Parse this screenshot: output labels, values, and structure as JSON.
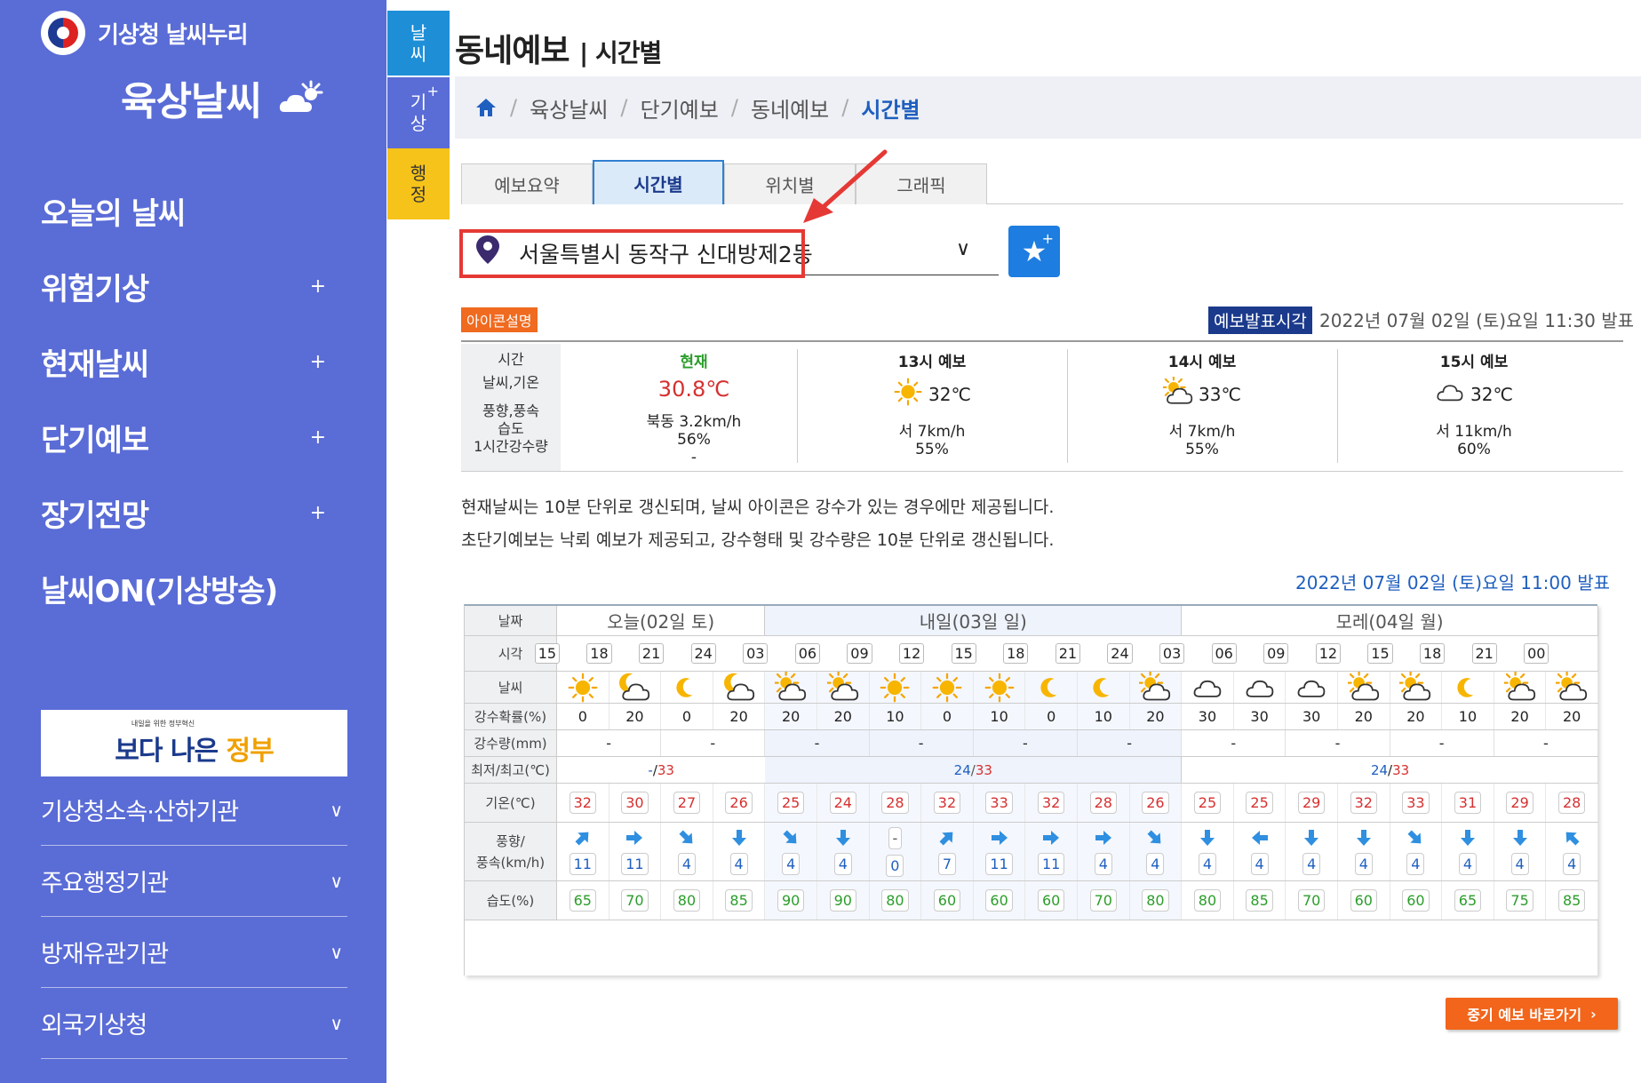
{
  "brand": {
    "name": "기상청 날씨누리"
  },
  "section_title": "육상날씨",
  "nav": [
    {
      "label": "오늘의 날씨",
      "plus": ""
    },
    {
      "label": "위험기상",
      "plus": "+"
    },
    {
      "label": "현재날씨",
      "plus": "+"
    },
    {
      "label": "단기예보",
      "plus": "+"
    },
    {
      "label": "장기전망",
      "plus": "+"
    },
    {
      "label": "날씨ON(기상방송)",
      "plus": ""
    }
  ],
  "banner": {
    "small": "내일을 위한 정부혁신",
    "big_a": "보다 나은",
    "big_b": "정부"
  },
  "orgs": [
    {
      "label": "기상청소속·산하기관"
    },
    {
      "label": "주요행정기관"
    },
    {
      "label": "방재유관기관"
    },
    {
      "label": "외국기상청"
    }
  ],
  "vtabs": [
    {
      "label": "날\n씨"
    },
    {
      "label": "기\n상",
      "sup": "+"
    },
    {
      "label": "행\n정"
    }
  ],
  "page": {
    "title": "동네예보",
    "subtitle": "| 시간별"
  },
  "breadcrumb": [
    "육상날씨",
    "단기예보",
    "동네예보",
    "시간별"
  ],
  "tabs": [
    {
      "label": "예보요약"
    },
    {
      "label": "시간별",
      "active": true
    },
    {
      "label": "위치별"
    },
    {
      "label": "그래픽"
    }
  ],
  "location": {
    "value": "서울특별시 동작구 신대방제2동"
  },
  "icon_desc": "아이콘설명",
  "issue": {
    "label": "예보발표시각",
    "time": "2022년 07월 02일 (토)요일 11:30 발표"
  },
  "now_labels": [
    "시간",
    "날씨,기온",
    "풍향,풍속",
    "습도",
    "1시간강수량"
  ],
  "now": [
    {
      "head": "현재",
      "temp": "30.8℃",
      "wind": "북동 3.2km/h",
      "hum": "56%",
      "rain": "-",
      "icon": ""
    },
    {
      "head": "13시 예보",
      "temp": "32℃",
      "wind": "서 7km/h",
      "hum": "55%",
      "icon": "sun"
    },
    {
      "head": "14시 예보",
      "temp": "33℃",
      "wind": "서 7km/h",
      "hum": "55%",
      "icon": "suncloud"
    },
    {
      "head": "15시 예보",
      "temp": "32℃",
      "wind": "서 11km/h",
      "hum": "60%",
      "icon": "cloud"
    }
  ],
  "notes": [
    "현재날씨는 10분 단위로 갱신되며, 날씨 아이콘은 강수가 있는 경우에만 제공됩니다.",
    "초단기예보는 낙뢰 예보가 제공되고, 강수형태 및 강수량은 10분 단위로 갱신됩니다."
  ],
  "forecast_issue": "2022년 07월 02일 (토)요일 11:00 발표",
  "grid": {
    "labels": {
      "date": "날짜",
      "time": "시각",
      "weather": "날씨",
      "pop": "강수확률(%)",
      "rain": "강수량(mm)",
      "minmax": "최저/최고(℃)",
      "temp": "기온(℃)",
      "wind_a": "풍향/",
      "wind_b": "풍속(km/h)",
      "hum": "습도(%)"
    },
    "days": [
      {
        "label": "오늘(02일 토)",
        "cols": 4
      },
      {
        "label": "내일(03일 일)",
        "cols": 8
      },
      {
        "label": "모레(04일 월)",
        "cols": 8
      }
    ],
    "times": [
      "15",
      "18",
      "21",
      "24",
      "03",
      "06",
      "09",
      "12",
      "15",
      "18",
      "21",
      "24",
      "03",
      "06",
      "09",
      "12",
      "15",
      "18",
      "21",
      "00"
    ],
    "weather": [
      "sun",
      "moon-cloud",
      "moon",
      "moon-cloud",
      "sun-cloud",
      "sun-cloud",
      "sun",
      "sun",
      "sun",
      "moon",
      "moon",
      "sun-cloud",
      "cloud",
      "cloud",
      "cloud",
      "sun-cloud",
      "sun-cloud",
      "moon",
      "sun-cloud",
      "sun-cloud"
    ],
    "pop": [
      "0",
      "20",
      "0",
      "20",
      "20",
      "20",
      "10",
      "0",
      "10",
      "0",
      "10",
      "20",
      "30",
      "30",
      "30",
      "20",
      "20",
      "10",
      "20",
      "20"
    ],
    "rain": [
      "-",
      "-",
      "-",
      "-",
      "-",
      "-",
      "-",
      "-",
      "-",
      "-"
    ],
    "minmax": [
      {
        "lo": "-",
        "hi": "33"
      },
      {
        "lo": "24",
        "hi": "33"
      },
      {
        "lo": "24",
        "hi": "33"
      }
    ],
    "temps": [
      "32",
      "30",
      "27",
      "26",
      "25",
      "24",
      "28",
      "32",
      "33",
      "32",
      "28",
      "26",
      "25",
      "25",
      "29",
      "32",
      "33",
      "31",
      "29",
      "28"
    ],
    "wind_dir": [
      "ne",
      "e",
      "se",
      "s",
      "se",
      "s",
      "-",
      "ne",
      "e",
      "e",
      "e",
      "se",
      "s",
      "w",
      "s",
      "s",
      "se",
      "s",
      "s",
      "nw"
    ],
    "wind_spd": [
      "11",
      "11",
      "4",
      "4",
      "4",
      "4",
      "0",
      "7",
      "11",
      "11",
      "4",
      "4",
      "4",
      "4",
      "4",
      "4",
      "4",
      "4",
      "4",
      "4"
    ],
    "hum": [
      "65",
      "70",
      "80",
      "85",
      "90",
      "90",
      "80",
      "60",
      "60",
      "60",
      "70",
      "80",
      "80",
      "85",
      "70",
      "60",
      "60",
      "65",
      "75",
      "85"
    ]
  },
  "mid_button": "중기 예보 바로가기",
  "colors": {
    "sidebar": "#5a6cd6",
    "accent": "#1e7de0",
    "warn": "#e53935",
    "orange": "#f2651b"
  }
}
